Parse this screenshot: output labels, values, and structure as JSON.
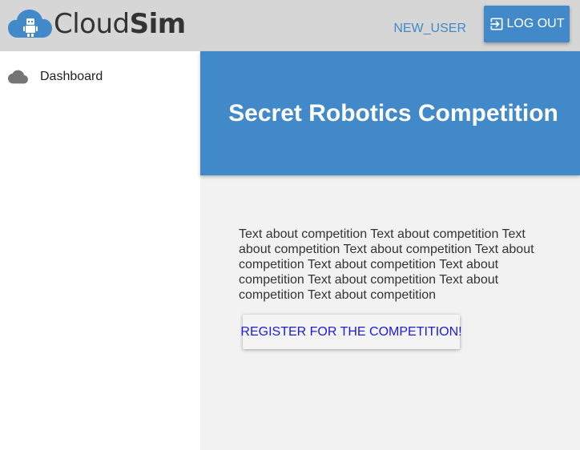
{
  "header": {
    "logo": {
      "text_regular": "Cloud",
      "text_bold": "Sim",
      "icon": "cloud-robot-icon"
    },
    "username": "NEW_USER",
    "logout_label": "LOG OUT",
    "logout_icon": "exit-to-app-icon"
  },
  "sidebar": {
    "items": [
      {
        "label": "Dashboard",
        "icon": "cloud-icon"
      }
    ]
  },
  "main": {
    "title": "Secret Robotics Competition",
    "description": "Text about competition Text about competition Text about competition Text about competition Text about competition Text about competition Text about competition Text about competition Text about competition Text about competition",
    "register_label": "REGISTER FOR THE COMPETITION!"
  },
  "colors": {
    "accent": "#4289c9",
    "topbar": "#d6d6d6",
    "content_bg": "#f2f2f2",
    "link_blue": "#1a1ae6"
  }
}
